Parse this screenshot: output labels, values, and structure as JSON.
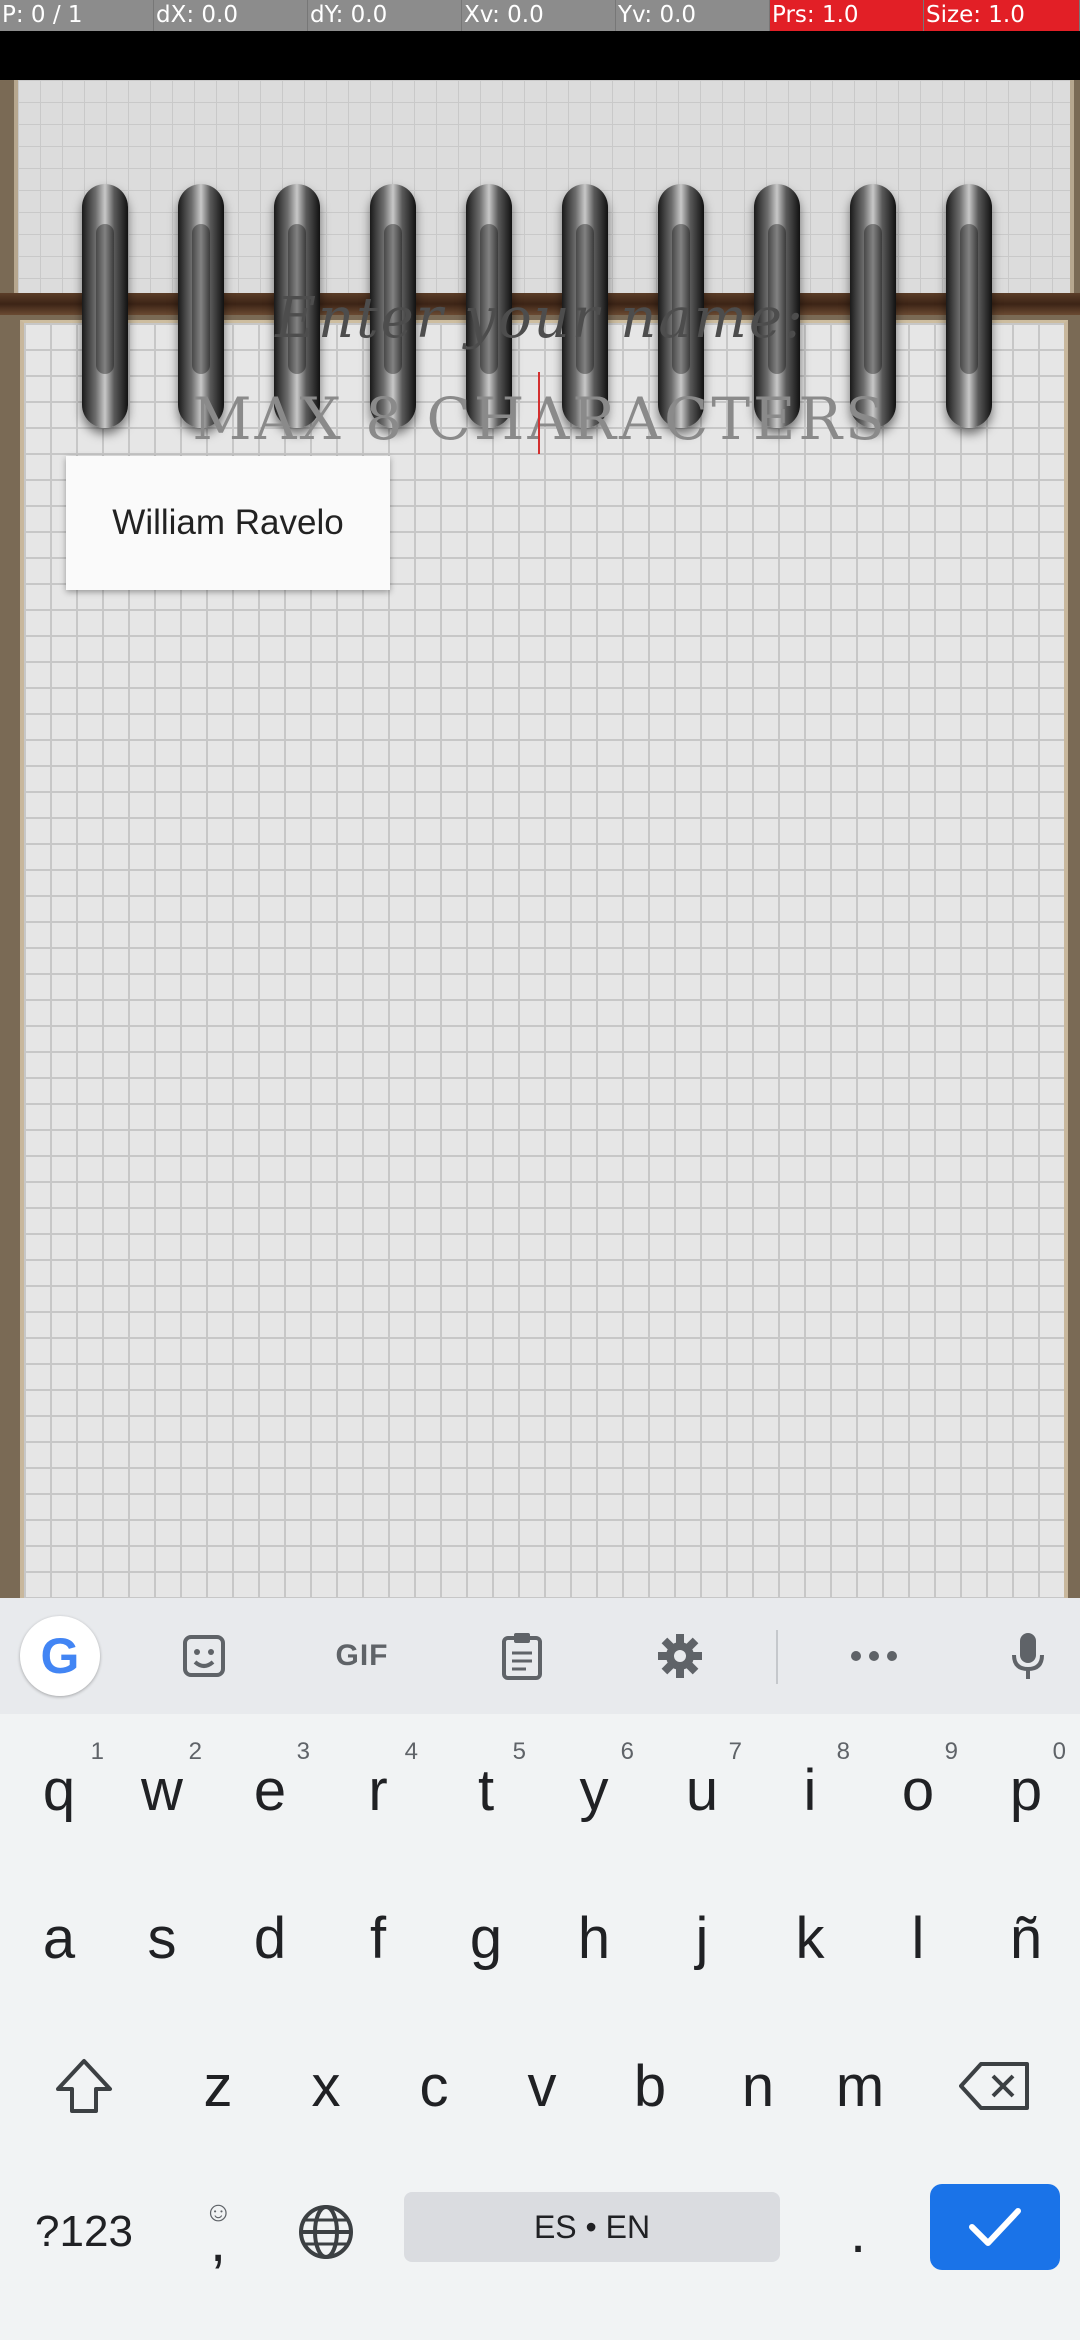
{
  "debug_bar": {
    "pointer": "P: 0 / 1",
    "dx": "dX: 0.0",
    "dy": "dY: 0.0",
    "xv": "Xv: 0.0",
    "yv": "Yv: 0.0",
    "prs": "Prs: 1.0",
    "size": "Size: 1.0"
  },
  "game": {
    "prompt_title": "Enter your name:",
    "prompt_subtitle": "MAX 8 CHARACTERS",
    "autofill_suggestion": "William Ravelo"
  },
  "keyboard": {
    "toolbar_icons": [
      "google-icon",
      "sticker-icon",
      "gif-icon",
      "clipboard-icon",
      "settings-icon",
      "more-icon",
      "mic-icon"
    ],
    "gif_label": "GIF",
    "row1": [
      {
        "key": "q",
        "hint": "1"
      },
      {
        "key": "w",
        "hint": "2"
      },
      {
        "key": "e",
        "hint": "3"
      },
      {
        "key": "r",
        "hint": "4"
      },
      {
        "key": "t",
        "hint": "5"
      },
      {
        "key": "y",
        "hint": "6"
      },
      {
        "key": "u",
        "hint": "7"
      },
      {
        "key": "i",
        "hint": "8"
      },
      {
        "key": "o",
        "hint": "9"
      },
      {
        "key": "p",
        "hint": "0"
      }
    ],
    "row2": [
      "a",
      "s",
      "d",
      "f",
      "g",
      "h",
      "j",
      "k",
      "l",
      "ñ"
    ],
    "row3": [
      "z",
      "x",
      "c",
      "v",
      "b",
      "n",
      "m"
    ],
    "symbols_label": "?123",
    "comma_label": ",",
    "space_label": "ES • EN",
    "period_label": ".",
    "accent_color": "#1a73e8"
  }
}
